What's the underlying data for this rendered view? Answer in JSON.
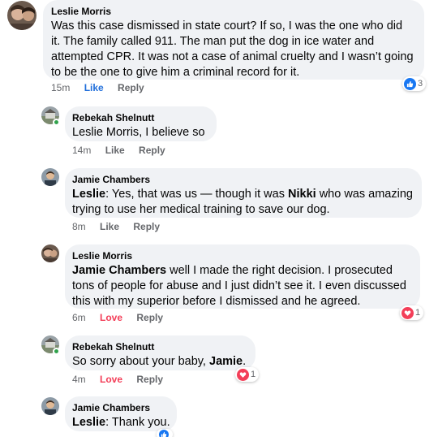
{
  "colors": {
    "bubble": "#f0f2f5",
    "like_blue": "#216fdb",
    "love_red": "#f33e58",
    "meta_gray": "#65676b",
    "online_green": "#31a24c"
  },
  "comments": [
    {
      "author": "Leslie Morris",
      "text_lines": [
        "Was this case dismissed in state court? If so, I was the one who did",
        "it. The family called 911. The man put the dog in ice water and",
        "attempted CPR. It was not a case of animal cruelty and I wasn’t going",
        "to be the one to give him a criminal record for it."
      ],
      "time": "15m",
      "action_label": "Like",
      "reply_label": "Reply",
      "reaction_icon": "like-icon",
      "reaction_count": "3"
    },
    {
      "author": "Rebekah Shelnutt",
      "mention": "Leslie Morris",
      "text": ", I believe so",
      "time": "14m",
      "action_label": "Like",
      "reply_label": "Reply"
    },
    {
      "author": "Jamie Chambers",
      "mention": "Leslie",
      "text_a": ": Yes, that was us — though it was ",
      "mention2": "Nikki",
      "text_b": " who was amazing",
      "text_line2": "trying to use her medical training to save our dog.",
      "time": "8m",
      "action_label": "Like",
      "reply_label": "Reply"
    },
    {
      "author": "Leslie Morris",
      "mention": "Jamie Chambers",
      "text_a": " well I made the right decision. I prosecuted",
      "text_line2": "tons of people for abuse and I just didn’t see it. I even discussed",
      "text_line3": "this with my superior before I dismissed and he agreed.",
      "time": "6m",
      "action_label": "Love",
      "reply_label": "Reply",
      "reaction_icon": "love-icon",
      "reaction_count": "1"
    },
    {
      "author": "Rebekah Shelnutt",
      "text_a": "So sorry about your baby, ",
      "mention": "Jamie",
      "text_b": ".",
      "time": "4m",
      "action_label": "Love",
      "reply_label": "Reply",
      "reaction_icon": "love-icon",
      "reaction_count": "1"
    },
    {
      "author": "Jamie Chambers",
      "mention": "Leslie",
      "text": ": Thank you."
    }
  ]
}
